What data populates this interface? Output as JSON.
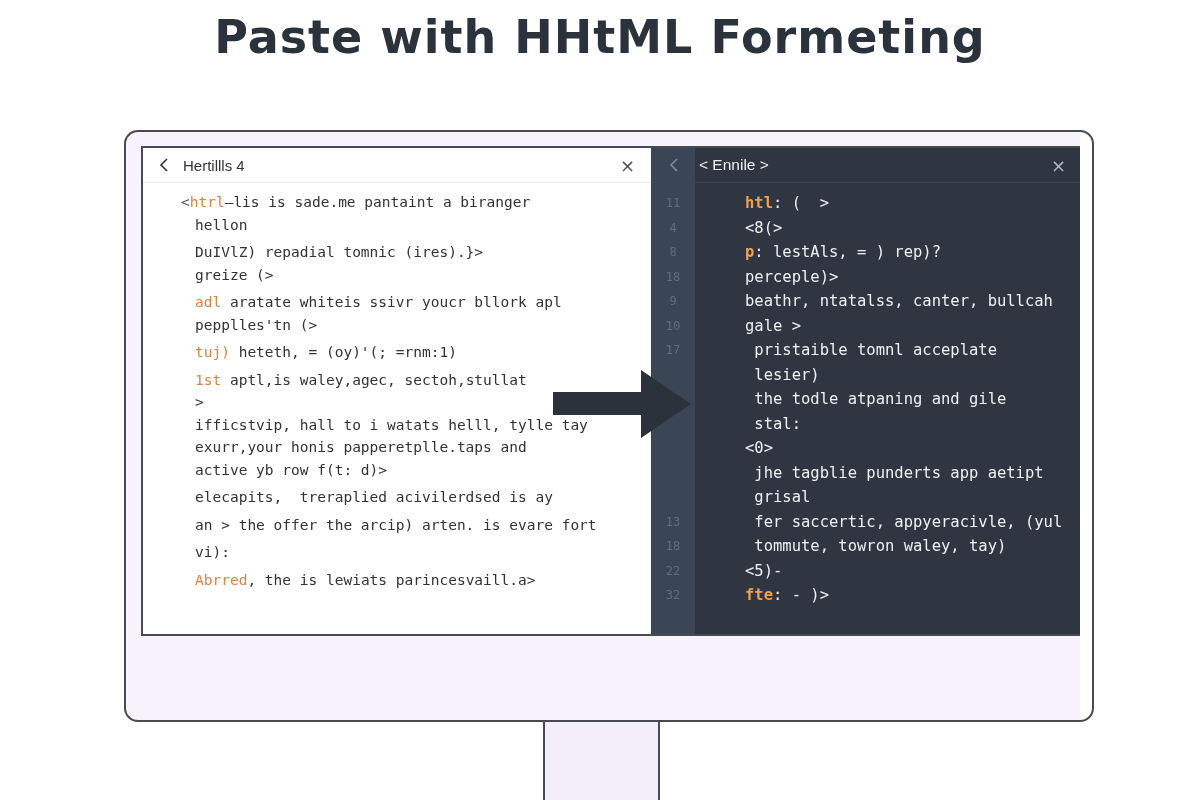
{
  "title": "Paste with HHtML Formeting",
  "left_panel": {
    "title": "Hertillls 4",
    "close": "×",
    "paragraphs": [
      [
        {
          "lead": "<",
          "tag": "htrl",
          "text": "—lis is sade.me pantaint a biranger"
        },
        {
          "text": "hellon"
        }
      ],
      [
        {
          "text": "DuIVlZ) repadial tomnic (ires).}>"
        },
        {
          "text": "greize (>"
        }
      ],
      [
        {
          "tag": "adl",
          "text": " aratate whiteis ssivr youcr bllork apl"
        },
        {
          "text": "pepplles'tn (>"
        }
      ],
      [
        {
          "tag": "tuj)",
          "text": " heteth, = (oy)'(; =rnm:1)"
        }
      ],
      [
        {
          "tag": "1st",
          "text": " aptl,is waley,agec, sectoh,stullat"
        },
        {
          "text": ">"
        },
        {
          "text": "ifficstvip, hall to i watats helll, tylle tay"
        },
        {
          "text": "exurr,your honis papperetplle.taps and"
        },
        {
          "text": "active yb row f(t: d)>"
        }
      ],
      [
        {
          "text": "elecapits,  treraplied acivilerdsed is ay"
        }
      ],
      [
        {
          "text": "an > the offer the arcip) arten. is evare fort"
        }
      ],
      [
        {
          "text": "vi):"
        }
      ],
      [
        {
          "tag": "Abrred",
          "text": ", the is lewiats parincesvaill.a>"
        }
      ]
    ]
  },
  "right_panel": {
    "title": "< Ennile >",
    "close": "×",
    "lines": [
      {
        "num": "11",
        "tag": "htl",
        "text": ": (  >"
      },
      {
        "num": "4",
        "text": "<8(>"
      },
      {
        "num": "8",
        "tag": "p",
        "text": ": lestAls, = ) rep)?"
      },
      {
        "num": "18",
        "text": "perceple)>"
      },
      {
        "num": "9",
        "text": "beathr, ntatalss, canter, bullcah"
      },
      {
        "num": "10",
        "text": "gale >"
      },
      {
        "num": "17",
        "text": " pristaible tomnl acceplate"
      },
      {
        "text": " lesier)"
      },
      {
        "text": " the todle atpaning and gile"
      },
      {
        "text": " stal:"
      },
      {
        "text": "<0>"
      },
      {
        "text": " jhe tagblie punderts app aetipt"
      },
      {
        "text": " grisal"
      },
      {
        "num": "13",
        "text": " fer saccertic, appyeracivle, (yul"
      },
      {
        "num": "18",
        "text": " tommute, towron waley, tay)"
      },
      {
        "num": "22",
        "text": "<5)-"
      },
      {
        "num": "32",
        "tag": "fte",
        "text": ": - )>"
      }
    ]
  }
}
